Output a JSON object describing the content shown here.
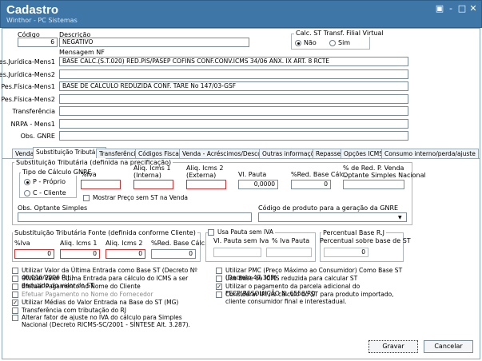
{
  "window": {
    "title": "Cadastro",
    "subtitle": "Winthor - PC Sistemas",
    "controls": {
      "restore": "▣",
      "minimize": "-",
      "maximize": "□",
      "close": "✕"
    }
  },
  "header": {
    "codigo_label": "Código",
    "codigo_value": "6",
    "descricao_label": "Descrição",
    "descricao_value": "NEGATIVO",
    "calc_st_label": "Calc. ST Transf. Filial Virtual",
    "radio_nao": "Não",
    "radio_sim": "Sim",
    "selected": "Não"
  },
  "mensagem": {
    "title": "Mensagem NF",
    "rows": [
      {
        "label": "Pes.Jurídica-Mens1",
        "value": "BASE CALC.(S.T.020) RED.PIS/PASEP COFINS CONF.CONV.ICMS 34/06 ANX. IX ART. 8 RCTE"
      },
      {
        "label": "Pes.Jurídica-Mens2",
        "value": ""
      },
      {
        "label": "Pes.Física-Mens1",
        "value": "BASE DE CALCULO REDUZIDA CONF. TARE No 147/03-GSF"
      },
      {
        "label": "Pes.Física-Mens2",
        "value": ""
      },
      {
        "label": "Transferência",
        "value": ""
      },
      {
        "label": "NRPA - Mens1",
        "value": ""
      },
      {
        "label": "Obs. GNRE",
        "value": ""
      }
    ]
  },
  "tabs": [
    "Venda",
    "Substituição Tributária",
    "Transferência",
    "Códigos Fiscais",
    "Venda - Acréscimos/Descontos",
    "Outras informações",
    "Repasse",
    "Opções ICMS",
    "Consumo interno/perda/ajuste"
  ],
  "st": {
    "group_title": "Substituição Tributária (definida na precificação)",
    "tipo_calc_title": "Tipo de Cálculo GNRE",
    "radio_p": "P - Próprio",
    "radio_c": "C - Cliente",
    "tipo_selected": "P - Próprio",
    "iva_label": "%Iva",
    "aliq1_label": "Aliq. Icms 1\n(Interna)",
    "aliq2_label": "Aliq. Icms 2\n(Externa)",
    "pauta_label": "Vl. Pauta",
    "pauta_value": "0,0000",
    "red_base_label": "%Red. Base Cálc.",
    "red_base_value": "0",
    "red_pvenda_label": "% de Red. P. Venda\nOptante Simples Nacional",
    "mostrar_preco": "Mostrar Preço sem ST na Venda",
    "obs_optante_label": "Obs. Optante Simples",
    "codigo_gnre_label": "Código de produto para a geração da GNRE"
  },
  "fonte": {
    "title": "Substituição Tributária Fonte (definida conforme Cliente)",
    "iva_label": "%Iva",
    "iva_value": "0",
    "aliq1_label": "Aliq. Icms 1",
    "aliq1_value": "0",
    "aliq2_label": "Aliq. Icms 2",
    "aliq2_value": "0",
    "red_label": "%Red. Base Cálc.",
    "red_value": "0"
  },
  "pauta_iva": {
    "title": "Usa Pauta sem IVA",
    "vl_label": "Vl. Pauta sem Iva",
    "iva_label": "% Iva Pauta"
  },
  "perc_base": {
    "title": "Percentual Base R.J",
    "label": "Percentual sobre base de ST",
    "value": "0"
  },
  "checks_left": [
    {
      "label": "Utilizar Valor da Última Entrada como Base ST (Decreto Nº 40.016/2006 R.J.)",
      "checked": false,
      "disabled": false
    },
    {
      "label": "Utilizar Valor Última Entrada para cálculo do ICMS a ser deduzido do valor do ST.",
      "checked": false,
      "disabled": false
    },
    {
      "label": "Efetuar Pagamento no Nome do Cliente",
      "checked": false,
      "disabled": false
    },
    {
      "label": "Efetuar Pagamento no Nome do Fornecedor",
      "checked": false,
      "disabled": true
    },
    {
      "label": "Utilizar Médias do Valor Entrada na Base do ST (MG)",
      "checked": true,
      "disabled": false
    },
    {
      "label": "Transferência com tributação do RJ",
      "checked": false,
      "disabled": false
    },
    {
      "label": "Alterar fator de ajuste no IVA do cálculo para Simples Nacional (Decreto RICMS-SC/2001 - SÍNTESE Alt. 3.287).",
      "checked": false,
      "disabled": false
    }
  ],
  "checks_right": [
    {
      "label": "Utilizar PMC (Preço Máximo ao Consumidor) Como Base ST (Decreto 47.363)",
      "checked": false
    },
    {
      "label": "Usa Base de ICMS reduzida para calcular ST",
      "checked": false
    },
    {
      "label": "Utilizar o pagamento da parcela adicional do FECP(RESOLUÇÃO N. 6556/RJ)",
      "checked": true
    },
    {
      "label": "Considerar IPI no cálculo do ST para produto importado, cliente consumidor final e interestadual.",
      "checked": false
    }
  ],
  "buttons": {
    "gravar": "Gravar",
    "cancelar": "Cancelar"
  },
  "colors": {
    "titlebar": "#3f76a8",
    "required_border": "#e02a2a"
  }
}
